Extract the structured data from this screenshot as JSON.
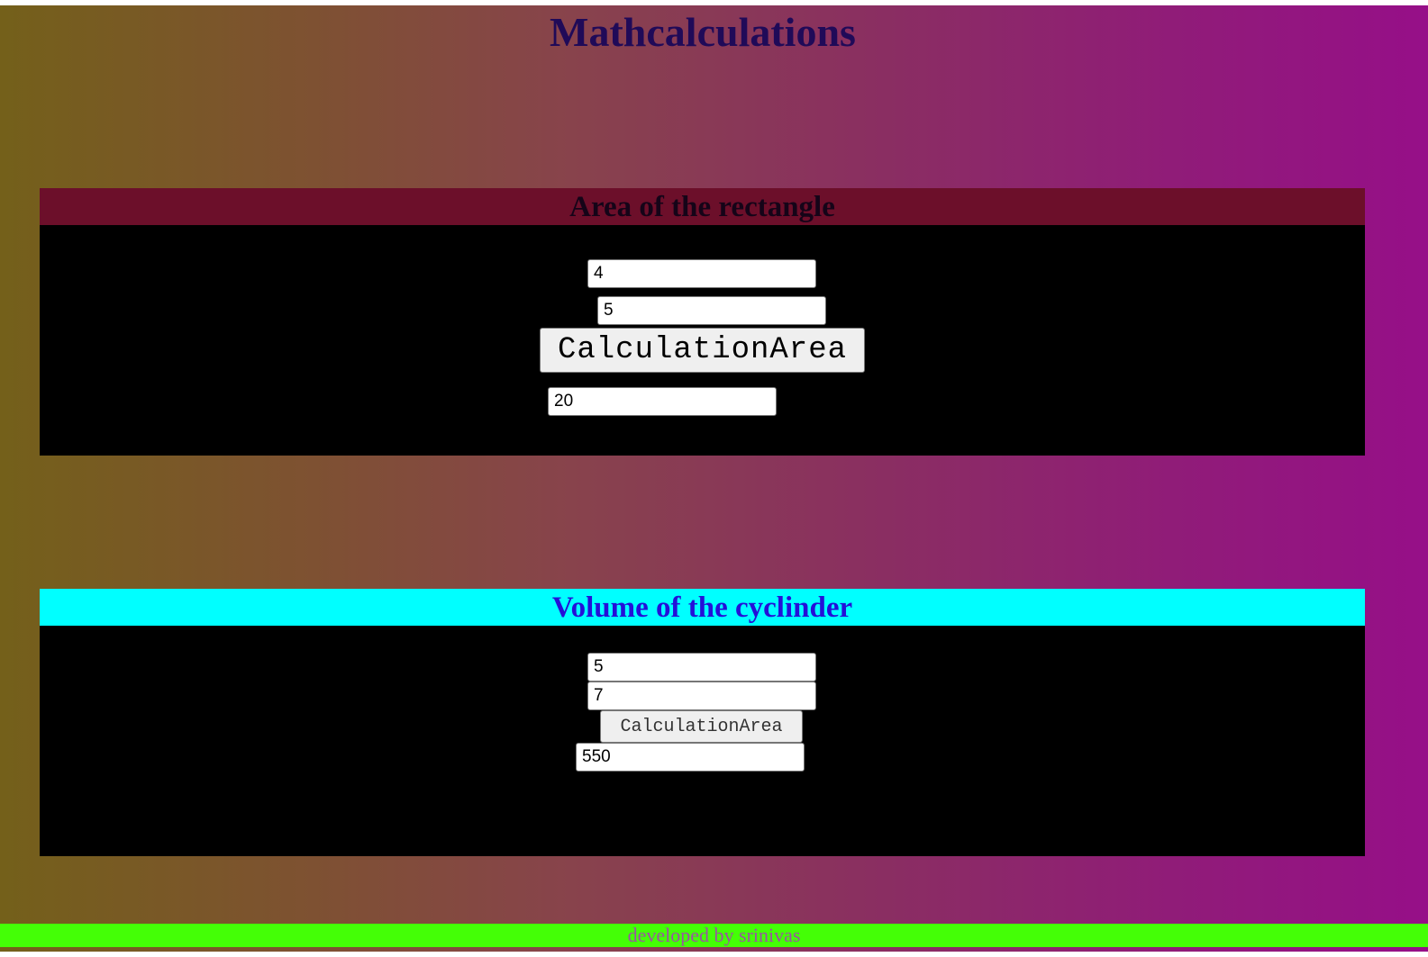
{
  "page": {
    "title": "Mathcalculations",
    "footer": "developed by srinivas"
  },
  "rectangle": {
    "heading": "Area of the rectangle",
    "length_value": "4",
    "width_value": "5",
    "button_label": "CalculationArea",
    "result_value": "20"
  },
  "cylinder": {
    "heading": "Volume of the cyclinder",
    "radius_value": "5",
    "height_value": "7",
    "button_label": "CalculationArea",
    "result_value": "550"
  },
  "colors": {
    "title": "#200a58",
    "rectangle_header_bg": "#6c0f2a",
    "cylinder_header_bg": "#00ffff",
    "cylinder_header_text": "#2410d8",
    "panel_bg": "#000000",
    "footer_bg": "#44ff06"
  }
}
